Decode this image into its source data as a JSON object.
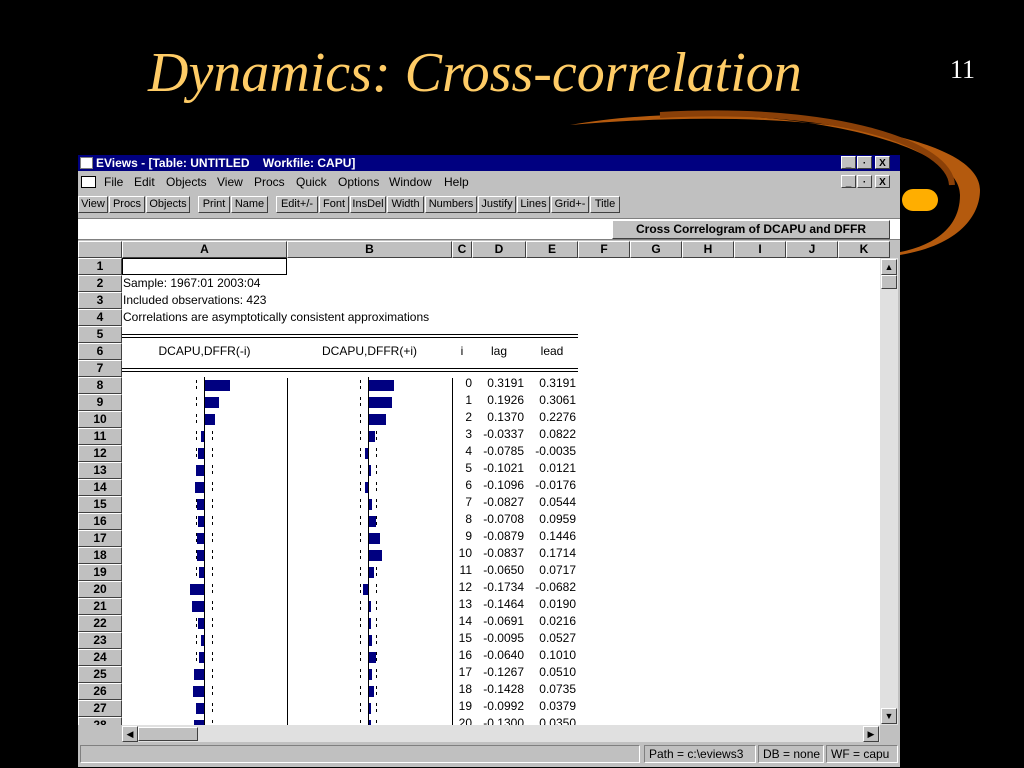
{
  "slide": {
    "title": "Dynamics: Cross-correlation",
    "page_number": "11"
  },
  "window": {
    "title": "EViews - [Table: UNTITLED    Workfile: CAPU]",
    "title_buttons": [
      "_",
      "·",
      "X"
    ],
    "menu": [
      "File",
      "Edit",
      "Objects",
      "View",
      "Procs",
      "Quick",
      "Options",
      "Window",
      "Help"
    ],
    "menu_buttons": [
      "_",
      "·",
      "X"
    ],
    "toolbar": [
      "View",
      "Procs",
      "Objects",
      "Print",
      "Name",
      "Edit+/-",
      "Font",
      "InsDel",
      "Width",
      "Numbers",
      "Justify",
      "Lines",
      "Grid+-",
      "Title"
    ],
    "table_title": "Cross Correlogram of DCAPU and DFFR",
    "columns": [
      "A",
      "B",
      "C",
      "D",
      "E",
      "F",
      "G",
      "H",
      "I",
      "J",
      "K"
    ],
    "row_numbers": [
      "1",
      "2",
      "3",
      "4",
      "5",
      "6",
      "7",
      "8",
      "9",
      "10",
      "11",
      "12",
      "13",
      "14",
      "15",
      "16",
      "17",
      "18",
      "19",
      "20",
      "21",
      "22",
      "23",
      "24",
      "25",
      "26",
      "27",
      "28"
    ],
    "info": {
      "sample": "Sample: 1967:01 2003:04",
      "obs": "Included observations: 423",
      "note": "Correlations are asymptotically consistent approximations"
    },
    "headers": {
      "a": "DCAPU,DFFR(-i)",
      "b": "DCAPU,DFFR(+i)",
      "i": "i",
      "lag": "lag",
      "lead": "lead"
    },
    "correlogram": [
      {
        "i": "0",
        "lag": "0.3191",
        "lead": "0.3191"
      },
      {
        "i": "1",
        "lag": "0.1926",
        "lead": "0.3061"
      },
      {
        "i": "2",
        "lag": "0.1370",
        "lead": "0.2276"
      },
      {
        "i": "3",
        "lag": "-0.0337",
        "lead": "0.0822"
      },
      {
        "i": "4",
        "lag": "-0.0785",
        "lead": "-0.0035"
      },
      {
        "i": "5",
        "lag": "-0.1021",
        "lead": "0.0121"
      },
      {
        "i": "6",
        "lag": "-0.1096",
        "lead": "-0.0176"
      },
      {
        "i": "7",
        "lag": "-0.0827",
        "lead": "0.0544"
      },
      {
        "i": "8",
        "lag": "-0.0708",
        "lead": "0.0959"
      },
      {
        "i": "9",
        "lag": "-0.0879",
        "lead": "0.1446"
      },
      {
        "i": "10",
        "lag": "-0.0837",
        "lead": "0.1714"
      },
      {
        "i": "11",
        "lag": "-0.0650",
        "lead": "0.0717"
      },
      {
        "i": "12",
        "lag": "-0.1734",
        "lead": "-0.0682"
      },
      {
        "i": "13",
        "lag": "-0.1464",
        "lead": "0.0190"
      },
      {
        "i": "14",
        "lag": "-0.0691",
        "lead": "0.0216"
      },
      {
        "i": "15",
        "lag": "-0.0095",
        "lead": "0.0527"
      },
      {
        "i": "16",
        "lag": "-0.0640",
        "lead": "0.1010"
      },
      {
        "i": "17",
        "lag": "-0.1267",
        "lead": "0.0510"
      },
      {
        "i": "18",
        "lag": "-0.1428",
        "lead": "0.0735"
      },
      {
        "i": "19",
        "lag": "-0.0992",
        "lead": "0.0379"
      },
      {
        "i": "20",
        "lag": "-0.1300",
        "lead": "0.0350"
      }
    ],
    "status": [
      "",
      "Path = c:\\eviews3",
      "DB = none",
      "WF = capu"
    ]
  },
  "colors": {
    "title": "#FFCC66",
    "bar": "#000080",
    "titlebar": "#000080",
    "chrome": "#c0c0c0"
  }
}
